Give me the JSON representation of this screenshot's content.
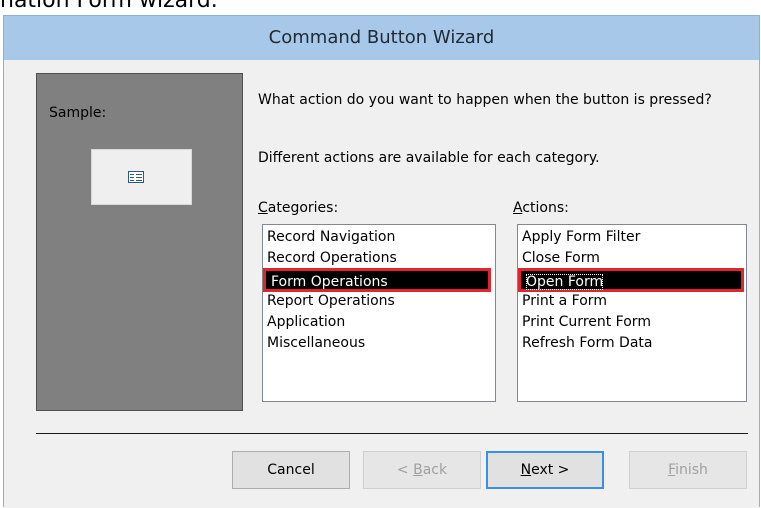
{
  "caption": {
    "text": "nation Form wizard."
  },
  "dialog": {
    "title": "Command Button Wizard"
  },
  "sample": {
    "label": "Sample:",
    "button_icon": "form-icon"
  },
  "prompt": {
    "question": "What action do you want to happen when the button is pressed?",
    "note": "Different actions are available for each category."
  },
  "categories": {
    "label_underlined": "C",
    "label_rest": "ategories:",
    "items": [
      "Record Navigation",
      "Record Operations",
      "Form Operations",
      "Report Operations",
      "Application",
      "Miscellaneous"
    ],
    "selected": "Form Operations"
  },
  "actions": {
    "label_underlined": "A",
    "label_rest": "ctions:",
    "items": [
      "Apply Form Filter",
      "Close Form",
      "Open Form",
      "Print a Form",
      "Print Current Form",
      "Refresh Form Data"
    ],
    "selected": "Open Form"
  },
  "buttons": {
    "cancel": "Cancel",
    "back_prefix": "< ",
    "back_underlined": "B",
    "back_rest": "ack",
    "next_underlined": "N",
    "next_rest": "ext >",
    "finish_underlined": "F",
    "finish_rest": "inish"
  },
  "colors": {
    "title_bar": "#a8c8ea",
    "selection_bg": "#000000",
    "highlight_border": "#e3232d",
    "default_button_border": "#3c8fe0"
  }
}
